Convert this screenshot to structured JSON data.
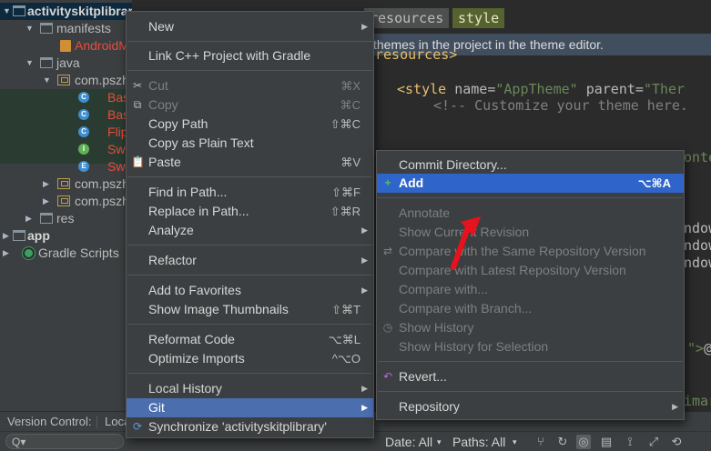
{
  "project_tree": {
    "items": [
      {
        "label": "activityskitplibrary",
        "style": "root"
      },
      {
        "label": "manifests",
        "style": "normal"
      },
      {
        "label": "AndroidManifest.xml",
        "style": "red"
      },
      {
        "label": "java",
        "style": "normal"
      },
      {
        "label": "com.pszh",
        "style": "normal"
      },
      {
        "label": "BaseActivity",
        "style": "red",
        "icon": "C"
      },
      {
        "label": "BaseSkitActivity",
        "style": "red",
        "icon": "C"
      },
      {
        "label": "FlipActivity",
        "style": "red",
        "icon": "C"
      },
      {
        "label": "SwipeListener",
        "style": "red",
        "icon": "I"
      },
      {
        "label": "SwipeBackActivity",
        "style": "red",
        "icon": "E"
      },
      {
        "label": "com.pszh",
        "style": "normal"
      },
      {
        "label": "com.pszh",
        "style": "normal"
      },
      {
        "label": "res",
        "style": "normal"
      },
      {
        "label": "app",
        "style": "bold"
      },
      {
        "label": "Gradle Scripts",
        "style": "normal"
      }
    ]
  },
  "editor": {
    "tab_resources": "resources",
    "tab_style": "style",
    "theme_banner": "themes in the project in the theme editor.",
    "line_resources_close": "resources>",
    "line_style_tag": "<style",
    "line_style_attr_name": "name=",
    "line_style_name_val": "\"AppTheme\"",
    "line_style_attr_parent": "parent=",
    "line_style_parent_val": "\"Ther",
    "line_comment": "<!-- Customize your theme here.",
    "line_onte": "onte",
    "line_window1": "ndow",
    "line_window2": "ndow",
    "line_window3": "ndow",
    "line_quote": "\">",
    "line_quote_c": "@",
    "line_imar": "imar"
  },
  "context_menu": {
    "items": [
      {
        "label": "New",
        "submenu": true
      },
      {
        "label": "Link C++ Project with Gradle"
      },
      {
        "label": "Cut",
        "shortcut": "⌘X",
        "disabled": true,
        "icon": "cut-icon"
      },
      {
        "label": "Copy",
        "shortcut": "⌘C",
        "disabled": true,
        "icon": "copy-icon"
      },
      {
        "label": "Copy Path",
        "shortcut": "⇧⌘C"
      },
      {
        "label": "Copy as Plain Text"
      },
      {
        "label": "Paste",
        "shortcut": "⌘V",
        "icon": "paste-icon"
      },
      {
        "label": "Find in Path...",
        "shortcut": "⇧⌘F"
      },
      {
        "label": "Replace in Path...",
        "shortcut": "⇧⌘R"
      },
      {
        "label": "Analyze",
        "submenu": true
      },
      {
        "label": "Refactor",
        "submenu": true
      },
      {
        "label": "Add to Favorites",
        "submenu": true
      },
      {
        "label": "Show Image Thumbnails",
        "shortcut": "⇧⌘T"
      },
      {
        "label": "Reformat Code",
        "shortcut": "⌥⌘L"
      },
      {
        "label": "Optimize Imports",
        "shortcut": "^⌥O"
      },
      {
        "label": "Local History",
        "submenu": true
      },
      {
        "label": "Git",
        "submenu": true,
        "active": true
      },
      {
        "label": "Synchronize 'activityskitplibrary'",
        "icon": "sync-icon"
      }
    ]
  },
  "git_submenu": {
    "items": [
      {
        "label": "Commit Directory..."
      },
      {
        "label": "Add",
        "shortcut": "⌥⌘A",
        "active": true,
        "icon": "plus-icon"
      },
      {
        "label": "Annotate",
        "disabled": true
      },
      {
        "label": "Show Current Revision",
        "disabled": true
      },
      {
        "label": "Compare with the Same Repository Version",
        "disabled": true,
        "icon": "compare-icon"
      },
      {
        "label": "Compare with Latest Repository Version",
        "disabled": true
      },
      {
        "label": "Compare with...",
        "disabled": true
      },
      {
        "label": "Compare with Branch...",
        "disabled": true
      },
      {
        "label": "Show History",
        "disabled": true,
        "icon": "history-icon"
      },
      {
        "label": "Show History for Selection",
        "disabled": true
      },
      {
        "label": "Revert...",
        "icon": "revert-icon"
      },
      {
        "label": "Repository",
        "submenu": true
      }
    ]
  },
  "version_control_bar": {
    "label": "Version Control:",
    "tab": "Loca"
  },
  "bottom_toolbar": {
    "search_icon": "Q▾",
    "date_filter": "Date: All",
    "paths_filter": "Paths: All"
  },
  "colors": {
    "menu_bg": "#3c3f41",
    "selection": "#4b6eaf",
    "annotation_arrow": "#e8121c"
  }
}
